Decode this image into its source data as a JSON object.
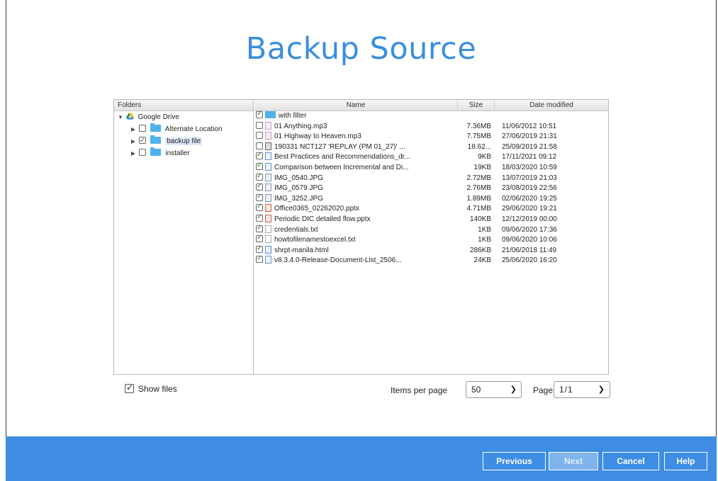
{
  "title": "Backup Source",
  "folders": {
    "header": "Folders",
    "root": "Google Drive",
    "items": [
      {
        "label": "Alternate Location",
        "checked": false
      },
      {
        "label": "backup file",
        "checked": true,
        "selected": true
      },
      {
        "label": "installer",
        "checked": false
      }
    ]
  },
  "files": {
    "headers": {
      "name": "Name",
      "size": "Size",
      "date": "Date modified"
    },
    "rows": [
      {
        "name": "with filter",
        "size": "",
        "date": "",
        "checked": true,
        "icon": "folder"
      },
      {
        "name": "01 Anything.mp3",
        "size": "7.36MB",
        "date": "11/06/2012 10:51",
        "checked": false,
        "icon": "music"
      },
      {
        "name": "01 Highway to Heaven.mp3",
        "size": "7.75MB",
        "date": "27/06/2019 21:31",
        "checked": false,
        "icon": "music"
      },
      {
        "name": "190331 NCT127 'REPLAY (PM 01_27)' ...",
        "size": "18.62...",
        "date": "25/09/2019 21:58",
        "checked": false,
        "icon": "video"
      },
      {
        "name": "Best Practices and Recommendations_dr...",
        "size": "9KB",
        "date": "17/11/2021 09:12",
        "checked": true,
        "icon": "doc"
      },
      {
        "name": "Comparison between Incremental and Di...",
        "size": "19KB",
        "date": "18/03/2020 10:59",
        "checked": true,
        "icon": "doc"
      },
      {
        "name": "IMG_0540.JPG",
        "size": "2.72MB",
        "date": "13/07/2019 21:03",
        "checked": true,
        "icon": "image"
      },
      {
        "name": "IMG_0579.JPG",
        "size": "2.76MB",
        "date": "23/08/2019 22:56",
        "checked": true,
        "icon": "image"
      },
      {
        "name": "IMG_3252.JPG",
        "size": "1.89MB",
        "date": "02/06/2020 19:25",
        "checked": true,
        "icon": "image"
      },
      {
        "name": "Office0365_02262020.pptx",
        "size": "4.71MB",
        "date": "29/06/2020 19:21",
        "checked": true,
        "icon": "ppt"
      },
      {
        "name": "Periodic DIC detailed flow.pptx",
        "size": "140KB",
        "date": "12/12/2019 00:00",
        "checked": true,
        "icon": "ppt"
      },
      {
        "name": "credentials.txt",
        "size": "1KB",
        "date": "09/06/2020 17:36",
        "checked": true,
        "icon": "txt"
      },
      {
        "name": "howtofilenamestoexcel.txt",
        "size": "1KB",
        "date": "09/06/2020 10:06",
        "checked": true,
        "icon": "txt"
      },
      {
        "name": "shrpt-manila.html",
        "size": "286KB",
        "date": "21/06/2018 11:49",
        "checked": true,
        "icon": "html"
      },
      {
        "name": "v8.3.4.0-Release-Document-List_2506...",
        "size": "24KB",
        "date": "25/06/2020 16:20",
        "checked": true,
        "icon": "doc"
      }
    ]
  },
  "controls": {
    "show_files": "Show files",
    "items_per_page_label": "Items per page",
    "items_per_page_value": "50",
    "page_label": "Page",
    "page_value": "1/1"
  },
  "buttons": {
    "previous": "Previous",
    "next": "Next",
    "cancel": "Cancel",
    "help": "Help"
  },
  "colors": {
    "title": "#3a8ee0",
    "footer": "#3e8de3",
    "folder": "#4fb3ea"
  }
}
